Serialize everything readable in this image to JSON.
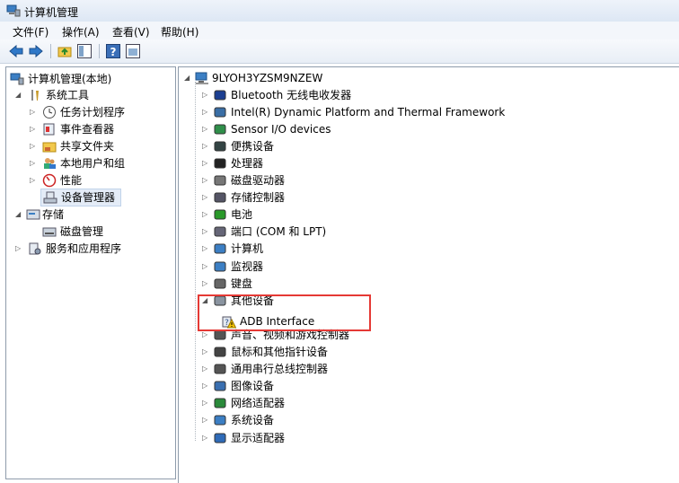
{
  "window": {
    "title": "计算机管理"
  },
  "menu": [
    "文件(F)",
    "操作(A)",
    "查看(V)",
    "帮助(H)"
  ],
  "toolbar": {
    "buttons": [
      "back-icon",
      "forward-icon",
      "up-folder-icon",
      "show-hide-tree-icon",
      "help-icon",
      "properties-icon"
    ]
  },
  "left_tree": {
    "root": "计算机管理(本地)",
    "system_tools": "系统工具",
    "task_scheduler": "任务计划程序",
    "event_viewer": "事件查看器",
    "shared_folders": "共享文件夹",
    "local_users": "本地用户和组",
    "performance": "性能",
    "device_manager": "设备管理器",
    "storage": "存储",
    "disk_management": "磁盘管理",
    "services": "服务和应用程序"
  },
  "device_tree": {
    "computer_name": "9LYOH3YZSM9NZEW",
    "categories": [
      "Bluetooth 无线电收发器",
      "Intel(R) Dynamic Platform and Thermal Framework",
      "Sensor I/O devices",
      "便携设备",
      "处理器",
      "磁盘驱动器",
      "存储控制器",
      "电池",
      "端口 (COM 和 LPT)",
      "计算机",
      "监视器",
      "键盘",
      "其他设备",
      "声音、视频和游戏控制器",
      "鼠标和其他指针设备",
      "通用串行总线控制器",
      "图像设备",
      "网络适配器",
      "系统设备",
      "显示适配器"
    ],
    "other_devices_child": "ADB Interface"
  },
  "colors": {
    "highlight_box": "#e53935",
    "warning": "#f5c400"
  }
}
